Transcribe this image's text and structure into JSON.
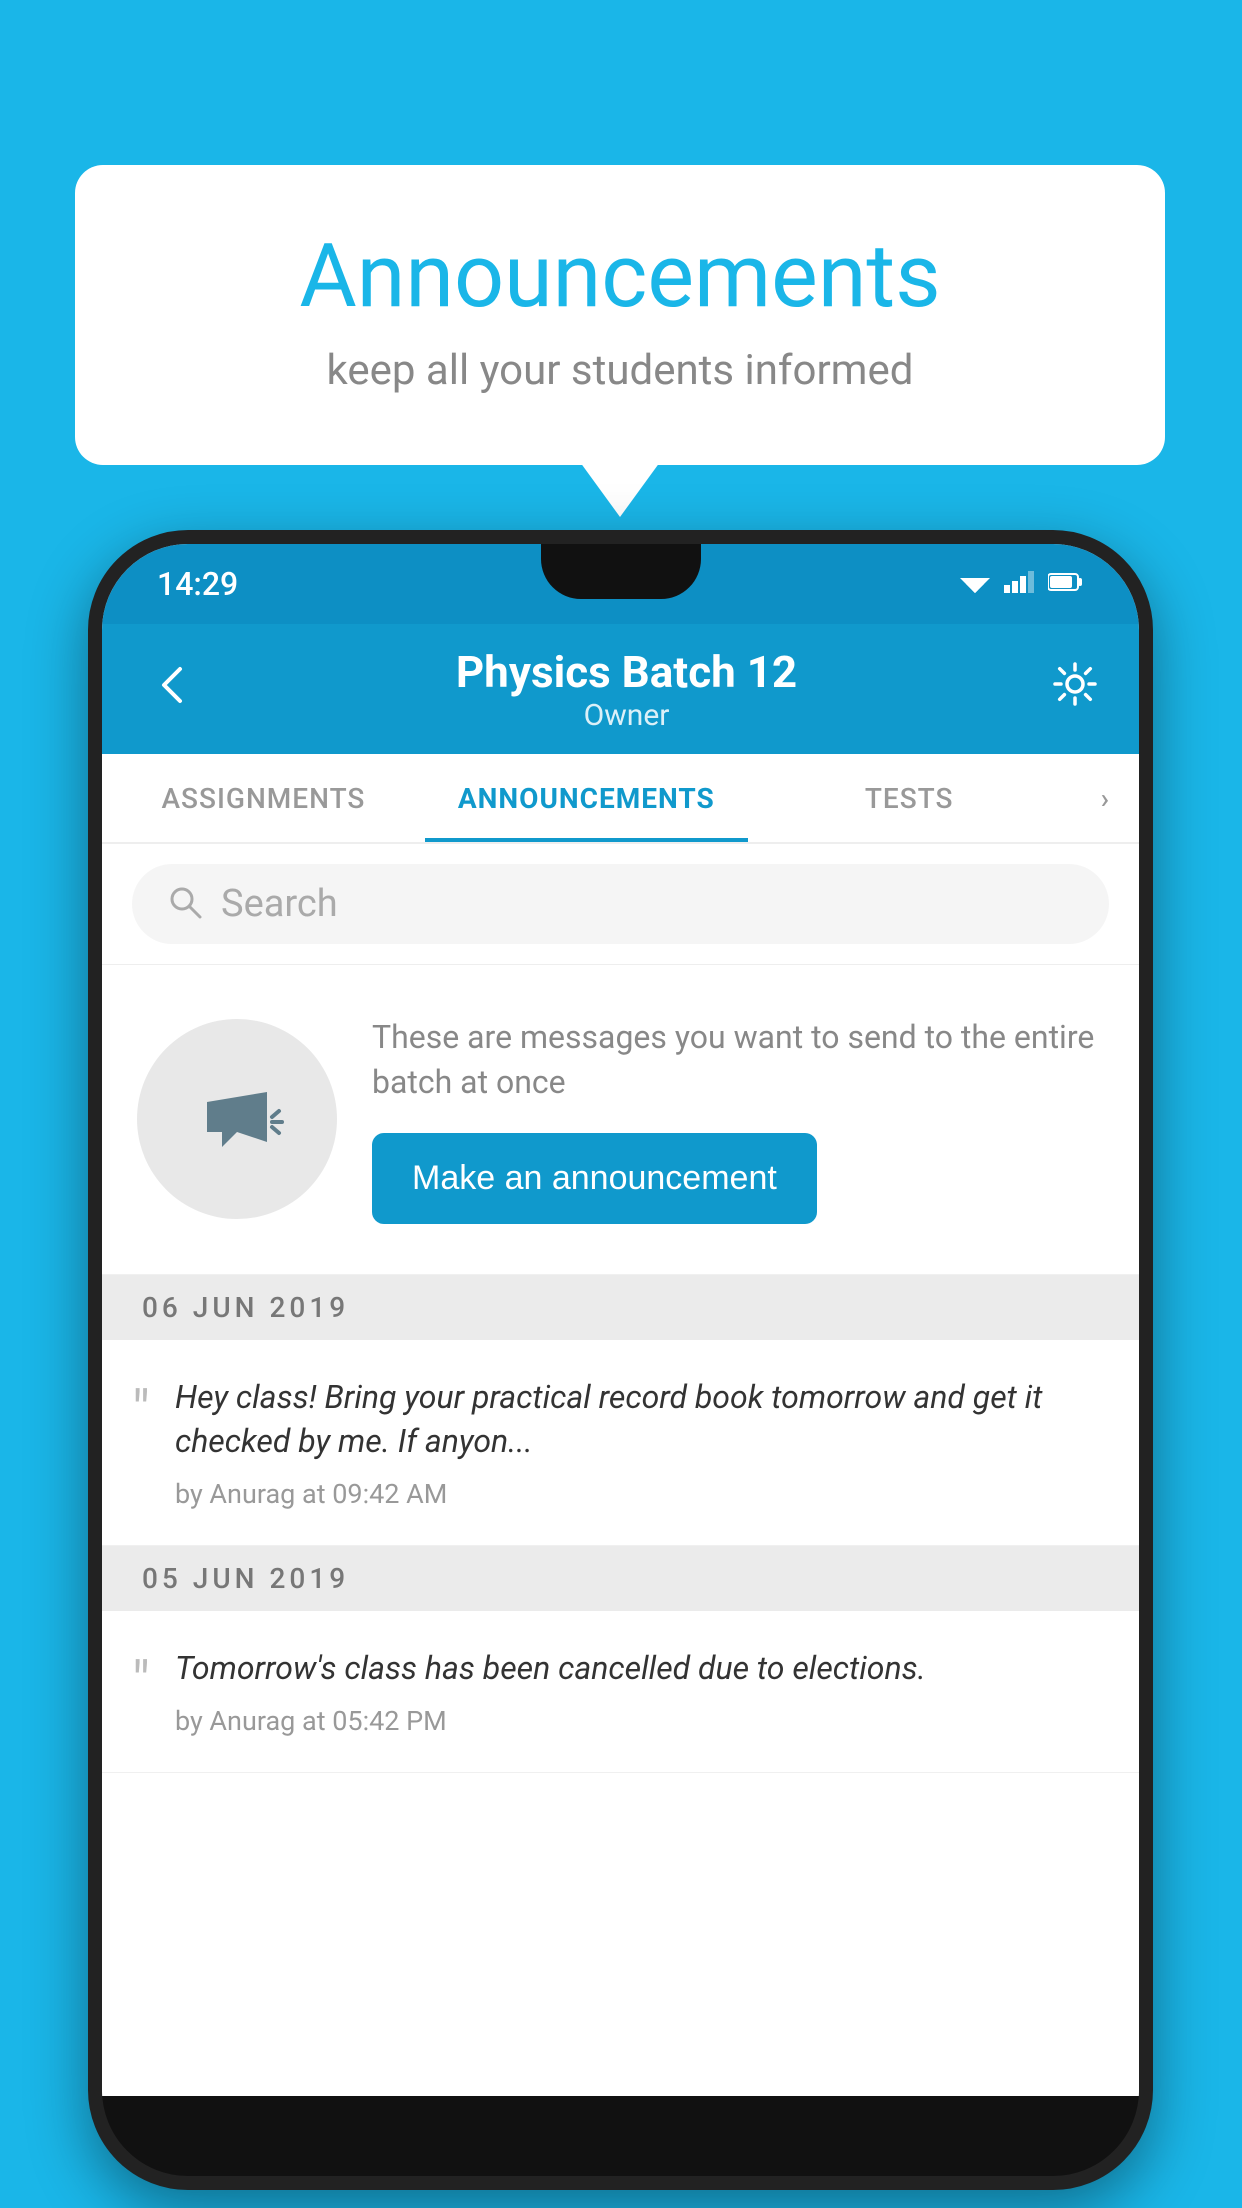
{
  "background_color": "#1ab6e8",
  "bubble": {
    "title": "Announcements",
    "subtitle": "keep all your students informed"
  },
  "phone": {
    "status_bar": {
      "time": "14:29"
    },
    "app_bar": {
      "title": "Physics Batch 12",
      "subtitle": "Owner"
    },
    "tabs": [
      {
        "label": "ASSIGNMENTS",
        "active": false
      },
      {
        "label": "ANNOUNCEMENTS",
        "active": true
      },
      {
        "label": "TESTS",
        "active": false
      }
    ],
    "search": {
      "placeholder": "Search"
    },
    "promo": {
      "text": "These are messages you want to send to the entire batch at once",
      "button_label": "Make an announcement"
    },
    "announcements": [
      {
        "date": "06  JUN  2019",
        "text": "Hey class! Bring your practical record book tomorrow and get it checked by me. If anyon...",
        "meta": "by Anurag at 09:42 AM"
      },
      {
        "date": "05  JUN  2019",
        "text": "Tomorrow's class has been cancelled due to elections.",
        "meta": "by Anurag at 05:42 PM"
      }
    ]
  }
}
